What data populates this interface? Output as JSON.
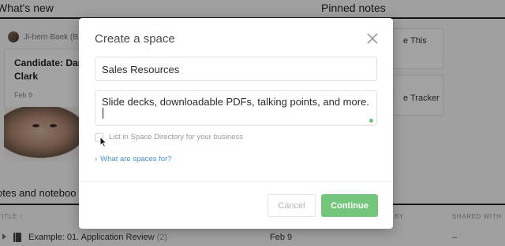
{
  "background": {
    "whats_new_title": "What's new",
    "pinned_notes_title": "Pinned notes",
    "feed_card": {
      "author": "Ji-hern Baek (B",
      "title": "Candidate: Dan Clark",
      "date": "Feb 9"
    },
    "pinned_items": [
      "e This",
      "e Tracker"
    ],
    "notes_section_title": "otes and noteboo",
    "table": {
      "headers": [
        "TITLE ↑",
        "BY",
        "SHARED WITH"
      ],
      "row": {
        "name": "Example: 01. Application Review",
        "count": "(2)",
        "date": "Feb 9",
        "shared": "–"
      }
    }
  },
  "modal": {
    "title": "Create a space",
    "name_value": "Sales Resources",
    "description_value": "Slide decks, downloadable PDFs, talking points, and more.",
    "directory_checkbox_label": "List in Space Directory for your business",
    "directory_checkbox_checked": false,
    "help_link": "What are spaces for?",
    "cancel_label": "Cancel",
    "continue_label": "Continue"
  },
  "colors": {
    "accent_green": "#74c77a",
    "link_blue": "#4a90c8",
    "overlay": "rgba(0,0,0,0.36)"
  },
  "icons": {
    "close": "close-icon",
    "help_chevron": "chevron-right-icon",
    "expand": "triangle-right-icon",
    "notebook": "notebook-icon",
    "pointer": "mouse-pointer-icon"
  }
}
